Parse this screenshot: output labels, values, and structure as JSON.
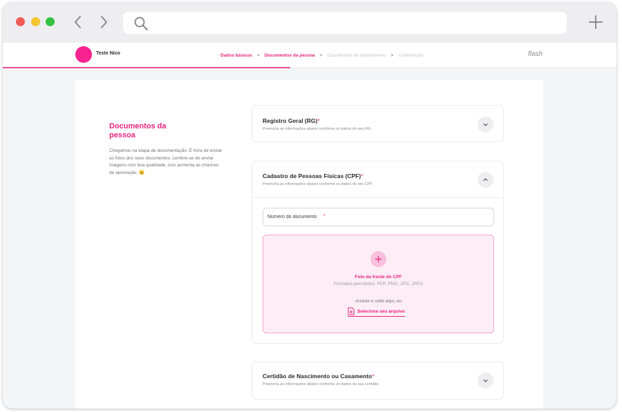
{
  "header": {
    "user_name": "Teste Nico",
    "brand": "flash",
    "steps": [
      {
        "label": "Dados básicos",
        "state": "active"
      },
      {
        "label": "Documentos da pessoa",
        "state": "active"
      },
      {
        "label": "Documentos de dependentes",
        "state": "inactive"
      },
      {
        "label": "Confirmação",
        "state": "inactive"
      }
    ],
    "step_separator": ">",
    "progress_fraction": 0.47
  },
  "intro": {
    "title": "Documentos da pessoa",
    "text": "Chegamos na etapa de documentação. É hora de enviar as fotos dos seus documentos. Lembre-se de enviar imagens com boa qualidade, isso aumenta as chances de aprovação. 😉"
  },
  "sections": {
    "rg": {
      "title": "Registro Geral (RG)",
      "required_mark": "*",
      "subtitle": "Preencha as informações abaixo conforme os dados do seu RG.",
      "expanded": false
    },
    "cpf": {
      "title": "Cadastro de Pessoas Físicas (CPF)",
      "required_mark": "*",
      "subtitle": "Preencha as informações abaixo conforme os dados do seu CPF",
      "expanded": true,
      "document_input": {
        "placeholder": "Número do documento",
        "required_mark": "*",
        "value": ""
      },
      "dropzone": {
        "title": "Foto da frente do CPF",
        "formats": "Formatos permitidos: PDF, PNG, JPG, JPEG",
        "drag_text": "Arraste e solte aqui, ou",
        "select_label": "Selecione seu arquivo"
      }
    },
    "cert": {
      "title": "Certidão de Nascimento ou Casamento",
      "required_mark": "*",
      "subtitle": "Preencha as informações abaixo conforme os dados da sua certidão.",
      "expanded": false
    }
  },
  "colors": {
    "accent": "#e8227e",
    "avatar": "#f7238f",
    "dropzone_bg": "#fdeef6",
    "dropzone_border": "#f6a4cb"
  },
  "icons": {
    "back": "chevron-left-icon",
    "forward": "chevron-right-icon",
    "search": "search-icon",
    "new_tab": "plus-icon",
    "expand": "chevron-down-icon",
    "collapse": "chevron-up-icon",
    "upload": "file-plus-icon"
  }
}
